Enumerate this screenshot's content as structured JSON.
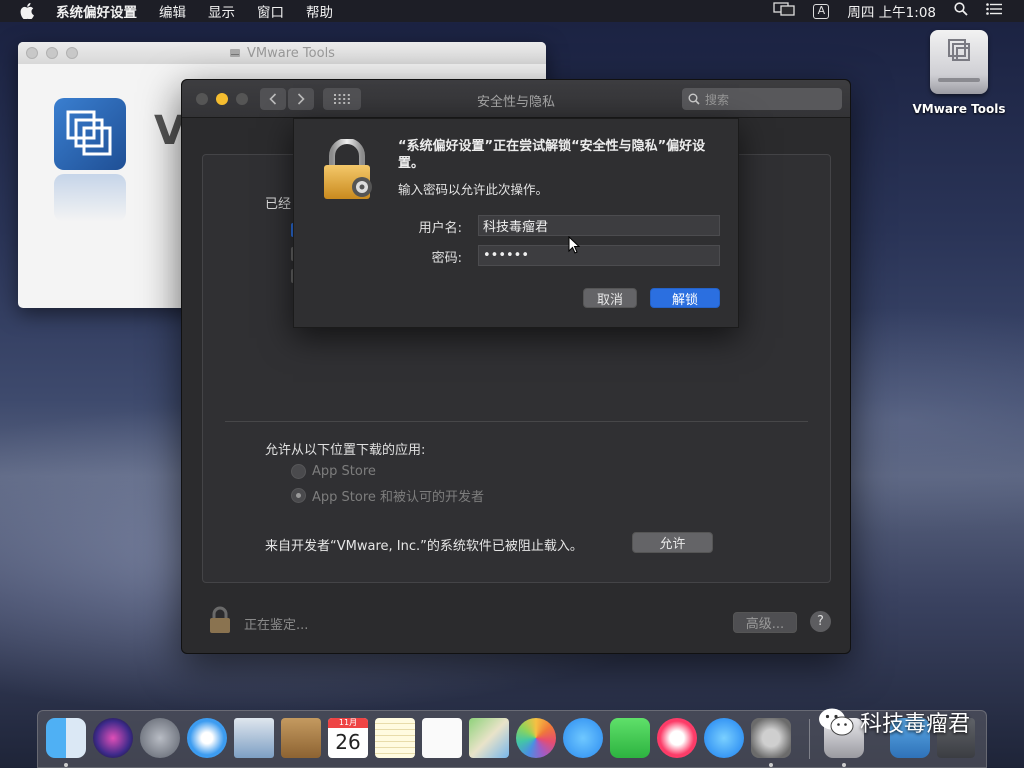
{
  "menubar": {
    "app_name": "系统偏好设置",
    "items": [
      "编辑",
      "显示",
      "窗口",
      "帮助"
    ],
    "input_badge": "A",
    "clock": "周四 上午1:08"
  },
  "desktop": {
    "icon_label": "VMware Tools"
  },
  "vmware_window": {
    "title": "VMware Tools",
    "big_letter": "V"
  },
  "prefs": {
    "title": "安全性与隐私",
    "search_placeholder": "搜索",
    "peek_text": "已经",
    "download_section_label": "允许从以下位置下载的应用:",
    "radio_options": [
      {
        "label": "App Store",
        "selected": false
      },
      {
        "label": "App Store 和被认可的开发者",
        "selected": true
      }
    ],
    "blocked_text": "来自开发者“VMware, Inc.”的系统软件已被阻止载入。",
    "allow_button": "允许",
    "status_text": "正在鉴定...",
    "advanced_button": "高级...",
    "help_button": "?"
  },
  "auth_dialog": {
    "message": "“系统偏好设置”正在尝试解锁“安全性与隐私”偏好设置。",
    "sub_message": "输入密码以允许此次操作。",
    "username_label": "用户名:",
    "username_value": "科技毒瘤君",
    "password_label": "密码:",
    "password_value": "••••••",
    "cancel_button": "取消",
    "unlock_button": "解锁"
  },
  "dock": {
    "apps": [
      "finder-icon",
      "siri-icon",
      "launchpad-icon",
      "safari-icon",
      "mail-icon",
      "contacts-icon",
      "calendar-icon",
      "notes-icon",
      "reminders-icon",
      "maps-icon",
      "photos-icon",
      "messages-icon",
      "facetime-icon",
      "music-icon",
      "app-store-icon",
      "system-preferences-icon"
    ],
    "calendar_month": "11月",
    "calendar_day": "26"
  },
  "watermark": "科技毒瘤君",
  "colors": {
    "accent": "#2b6fe0",
    "minimize_yellow": "#f5bd2f"
  }
}
